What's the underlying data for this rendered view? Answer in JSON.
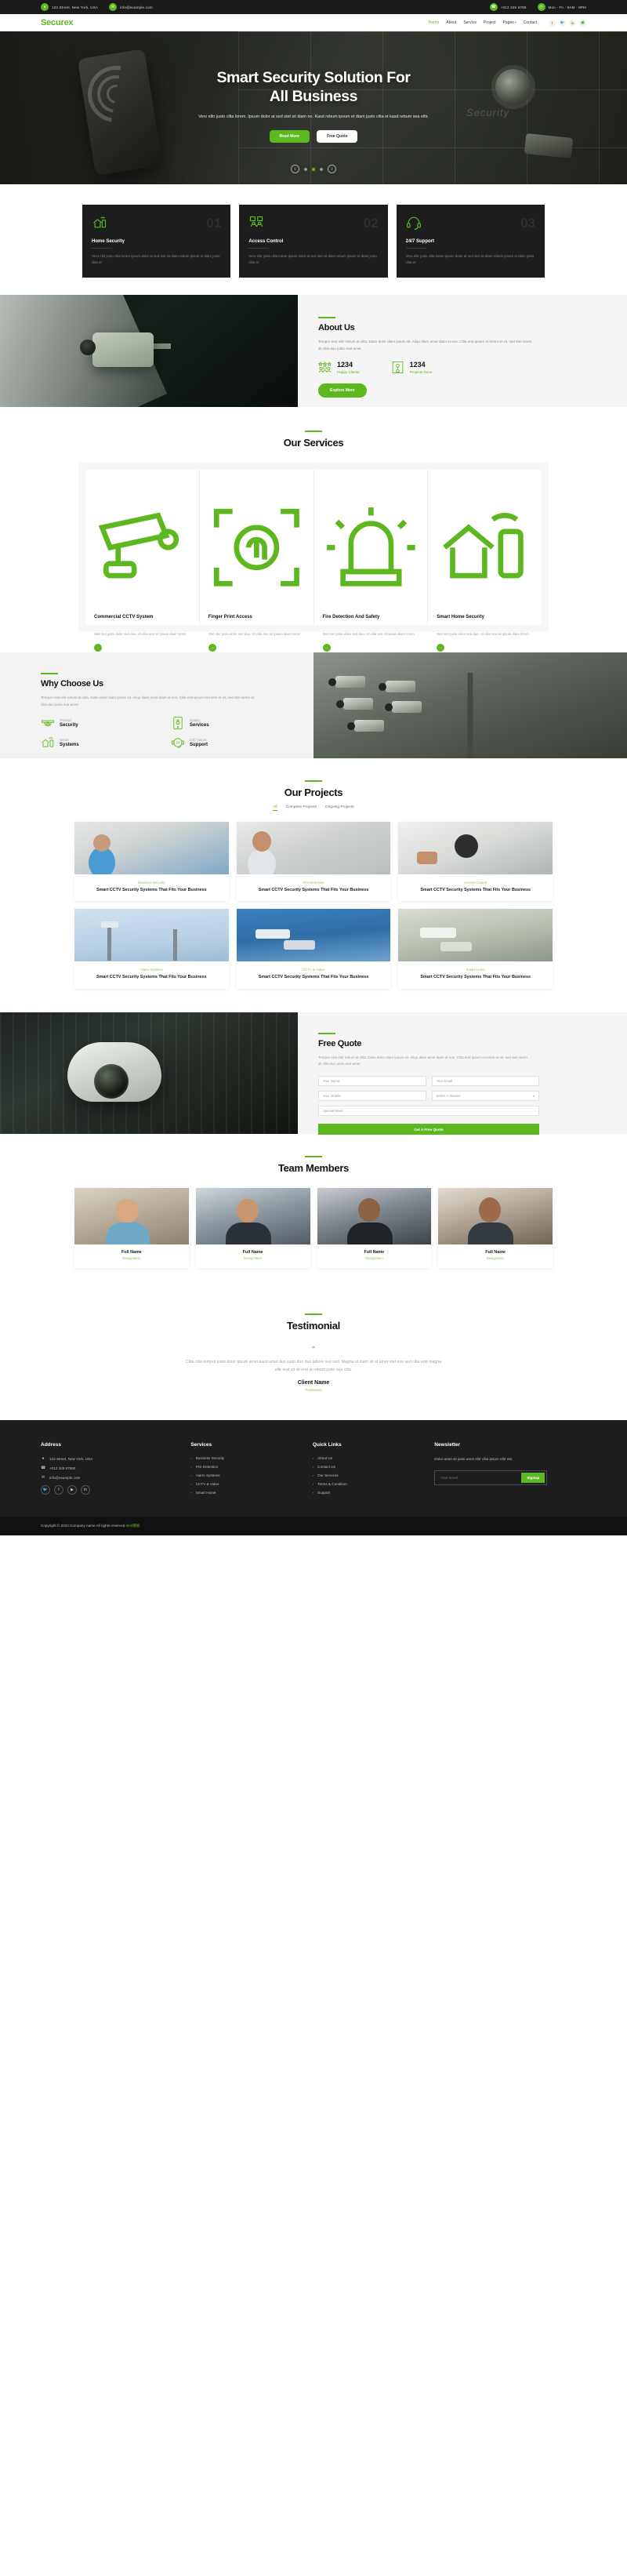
{
  "topbar": {
    "address": "123 Street, New York, USA",
    "email": "info@example.com",
    "phone": "+012 345 6789",
    "hours": "Mon - Fri : 9AM - 9PM"
  },
  "nav": {
    "logo": "Securex",
    "links": [
      {
        "label": "Home",
        "active": true
      },
      {
        "label": "About",
        "active": false
      },
      {
        "label": "Service",
        "active": false
      },
      {
        "label": "Project",
        "active": false
      },
      {
        "label": "Pages",
        "active": false,
        "caret": "▾"
      },
      {
        "label": "Contact",
        "active": false
      }
    ],
    "social": [
      "f",
      "🐦",
      "in",
      "▣"
    ]
  },
  "hero": {
    "title_line1": "Smart Security Solution For",
    "title_line2": "All Business",
    "subtitle": "Vero elitr justo clita lorem. Ipsum dolor at sed stet sit diam no. Kasd rebum ipsum et diam justo clita et kasd rebum sea elitr.",
    "btn_primary": "Read More",
    "btn_secondary": "Free Quote",
    "prev": "‹",
    "next": "›",
    "watermark": "Security"
  },
  "features": [
    {
      "num": "01",
      "title": "Home Security",
      "desc": "Vero elitr justo clita lorem ipsum dolor at sed stet sit diam rebum ipsum et diam justo clita et"
    },
    {
      "num": "02",
      "title": "Access Control",
      "desc": "Vero elitr justo clita lorem ipsum dolor at sed stet sit diam rebum ipsum et diam justo clita et"
    },
    {
      "num": "03",
      "title": "24/7 Support",
      "desc": "Vero elitr justo clita lorem ipsum dolor at sed stet sit diam rebum ipsum et diam justo clita et"
    }
  ],
  "about": {
    "title": "About Us",
    "desc": "Tempor erat elitr rebum at clita. Diam dolor diam ipsum sit. Aliqu diam amet diam et eos. Clita erat ipsum et lorem et sit, sed stet lorem sit clita duo justo erat amet",
    "stat1_num": "1234",
    "stat1_label": "Happy Clients",
    "stat2_num": "1234",
    "stat2_label": "Projects Done",
    "button": "Explore More"
  },
  "services": {
    "title": "Our Services",
    "items": [
      {
        "title": "Commercial CCTV System",
        "desc": "Stet stet justo dolor sed duo. Ut clita sea sit ipsum diam lorem"
      },
      {
        "title": "Finger Print Access",
        "desc": "Stet stet justo dolor sed duo. Ut clita sea sit ipsum diam lorem"
      },
      {
        "title": "Fire Detection And Safety",
        "desc": "Stet stet justo dolor sed duo. Ut clita sea sit ipsum diam lorem"
      },
      {
        "title": "Smart Home Security",
        "desc": "Stet stet justo dolor sed duo. Ut clita sea sit ipsum diam lorem"
      }
    ],
    "arrow": "→"
  },
  "why": {
    "title": "Why Choose Us",
    "desc": "Tempor erat elitr rebum at clita. Diam dolor diam ipsum sit. Aliqu diam amet diam et eos. Clita erat ipsum et lorem et sit, sed stet lorem sit clita duo justo erat amet",
    "items": [
      {
        "small": "Trusted",
        "big": "Security"
      },
      {
        "small": "Quality",
        "big": "Services"
      },
      {
        "small": "Smart",
        "big": "Systems"
      },
      {
        "small": "24/7 Hours",
        "big": "Support"
      }
    ]
  },
  "projects": {
    "title": "Our Projects",
    "tabs": [
      {
        "label": "All",
        "active": true
      },
      {
        "label": "Complete Projects",
        "active": false
      },
      {
        "label": "Ongoing Projects",
        "active": false
      }
    ],
    "items": [
      {
        "cat": "Business Security",
        "name": "Smart CCTV Security Systems That Fits Your Business"
      },
      {
        "cat": "Fire Detection",
        "name": "Smart CCTV Security Systems That Fits Your Business"
      },
      {
        "cat": "Access Control",
        "name": "Smart CCTV Security Systems That Fits Your Business"
      },
      {
        "cat": "Alarm Systems",
        "name": "Smart CCTV Security Systems That Fits Your Business"
      },
      {
        "cat": "CCTV & Video",
        "name": "Smart CCTV Security Systems That Fits Your Business"
      },
      {
        "cat": "Smart Home",
        "name": "Smart CCTV Security Systems That Fits Your Business"
      }
    ]
  },
  "quote": {
    "title": "Free Quote",
    "desc": "Tempor erat elitr rebum at clita. Diam dolor diam ipsum sit. Aliqu diam amet diam et eos. Clita erat ipsum et lorem et sit, sed stet lorem sit clita duo justo erat amet",
    "name_placeholder": "Your Name",
    "email_placeholder": "Your Email",
    "mobile_placeholder": "Your Mobile",
    "select_placeholder": "Select A Service",
    "need_placeholder": "Special Need",
    "submit": "Get A Free Quote"
  },
  "team": {
    "title": "Team Members",
    "members": [
      {
        "name": "Full Name",
        "role": "Designation"
      },
      {
        "name": "Full Name",
        "role": "Designation"
      },
      {
        "name": "Full Name",
        "role": "Designation"
      },
      {
        "name": "Full Name",
        "role": "Designation"
      }
    ]
  },
  "testimonial": {
    "title": "Testimonial",
    "mark": "“",
    "text": "Clita clita tempor justo dolor ipsum amet kasd amet duo justo duo duo labore sed sed. Magna ut diam sit et amet stet eos sed clita erat magna elitr erat sit sit erat at rebum justo sea clita.",
    "client": "Client Name",
    "profession": "Profession"
  },
  "footer": {
    "address_head": "Address",
    "address_line": "123 Street, New York, USA",
    "phone_line": "+012 345 67890",
    "email_line": "info@example.com",
    "social": [
      "🐦",
      "f",
      "▶",
      "in"
    ],
    "services_head": "Services",
    "services": [
      "Business Security",
      "Fire Detection",
      "Alarm Systems",
      "CCTV & Video",
      "Smart Home"
    ],
    "quick_head": "Quick Links",
    "quick": [
      "About Us",
      "Contact Us",
      "Our Services",
      "Terms & Condition",
      "Support"
    ],
    "news_head": "Newsletter",
    "news_desc": "Dolor amet sit justo amet elitr clita ipsum elitr est.",
    "news_placeholder": "Your email",
    "news_btn": "SignUp",
    "chevron": "›",
    "copyright_a": "Copyright © 2022.Company name All rights reserved.",
    "copyright_b": "html模板"
  },
  "colors": {
    "accent": "#5cb81e",
    "dark": "#1d1d1d",
    "darker": "#111111"
  }
}
